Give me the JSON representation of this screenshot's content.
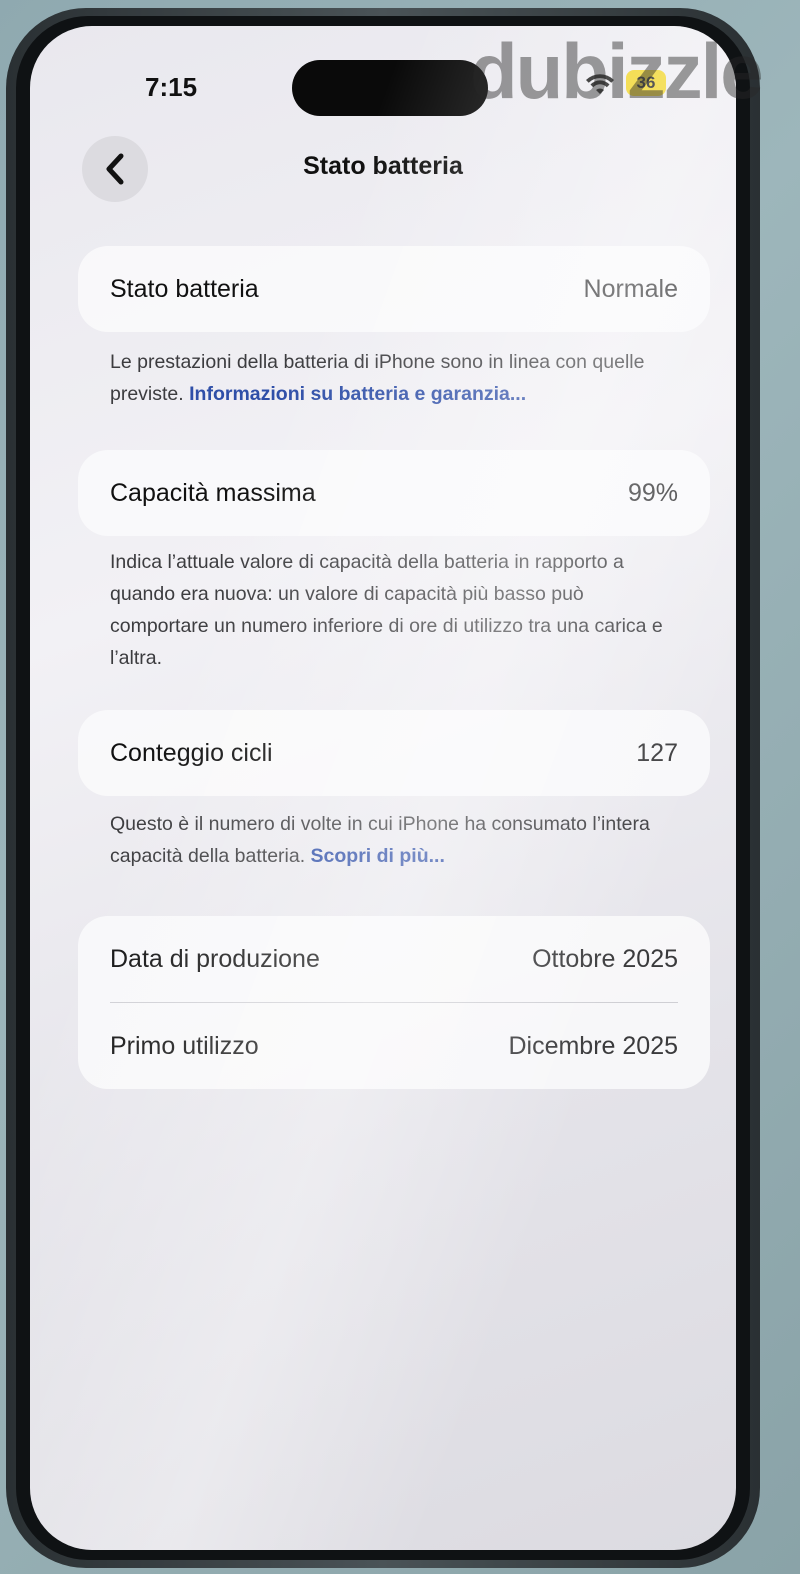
{
  "status_bar": {
    "time": "7:15",
    "battery_level": "36"
  },
  "watermark": "dubizzle",
  "header": {
    "title": "Stato batteria"
  },
  "battery_health": {
    "label": "Stato batteria",
    "value": "Normale",
    "note": "Le prestazioni della batteria di iPhone sono in linea con quelle previste.",
    "link": "Informazioni su batteria e garanzia..."
  },
  "max_capacity": {
    "label": "Capacità massima",
    "value": "99%",
    "note": "Indica l’attuale valore di capacità della batteria in rapporto a quando era nuova: un valore di capacità più basso può comportare un numero inferiore di ore di utilizzo tra una carica e l’altra."
  },
  "cycle_count": {
    "label": "Conteggio cicli",
    "value": "127",
    "note": "Questo è il numero di volte in cui iPhone ha consumato l’intera capacità della batteria.",
    "link": "Scopri di più..."
  },
  "dates": {
    "manufacture_label": "Data di produzione",
    "manufacture_value": "Ottobre 2025",
    "first_use_label": "Primo utilizzo",
    "first_use_value": "Dicembre 2025"
  },
  "colors": {
    "link": "#2f4fa8",
    "battery_badge": "#f0d21a"
  },
  "icons": [
    "back-icon",
    "wifi-icon",
    "battery-icon"
  ]
}
